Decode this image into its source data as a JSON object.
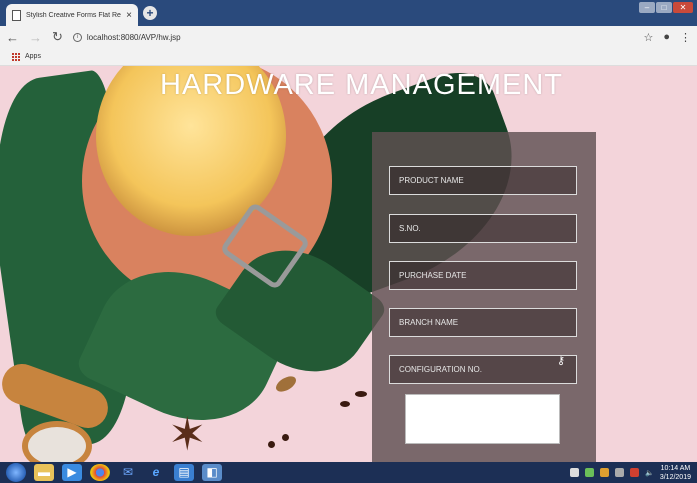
{
  "browser": {
    "tab_title": "Stylish Creative Forms Flat Resp",
    "tab_close": "×",
    "new_tab": "+",
    "url": "localhost:8080/AVP/hw.jsp",
    "bookmarks_apps": "Apps"
  },
  "page": {
    "heading": "HARDWARE MANAGEMENT",
    "fields": [
      {
        "placeholder": "PRODUCT NAME"
      },
      {
        "placeholder": "S.NO."
      },
      {
        "placeholder": "PURCHASE DATE"
      },
      {
        "placeholder": "BRANCH NAME"
      },
      {
        "placeholder": "CONFIGURATION NO."
      }
    ],
    "colors": {
      "panel": "#5f5052",
      "heading": "#ffffff",
      "background": "#f3d4da"
    }
  },
  "taskbar": {
    "time": "10:14 AM",
    "date": "3/12/2019",
    "icons": [
      "start-orb",
      "file-explorer-icon",
      "media-player-icon",
      "chrome-icon",
      "email-icon",
      "internet-explorer-icon",
      "notepad-icon",
      "app-icon"
    ]
  }
}
